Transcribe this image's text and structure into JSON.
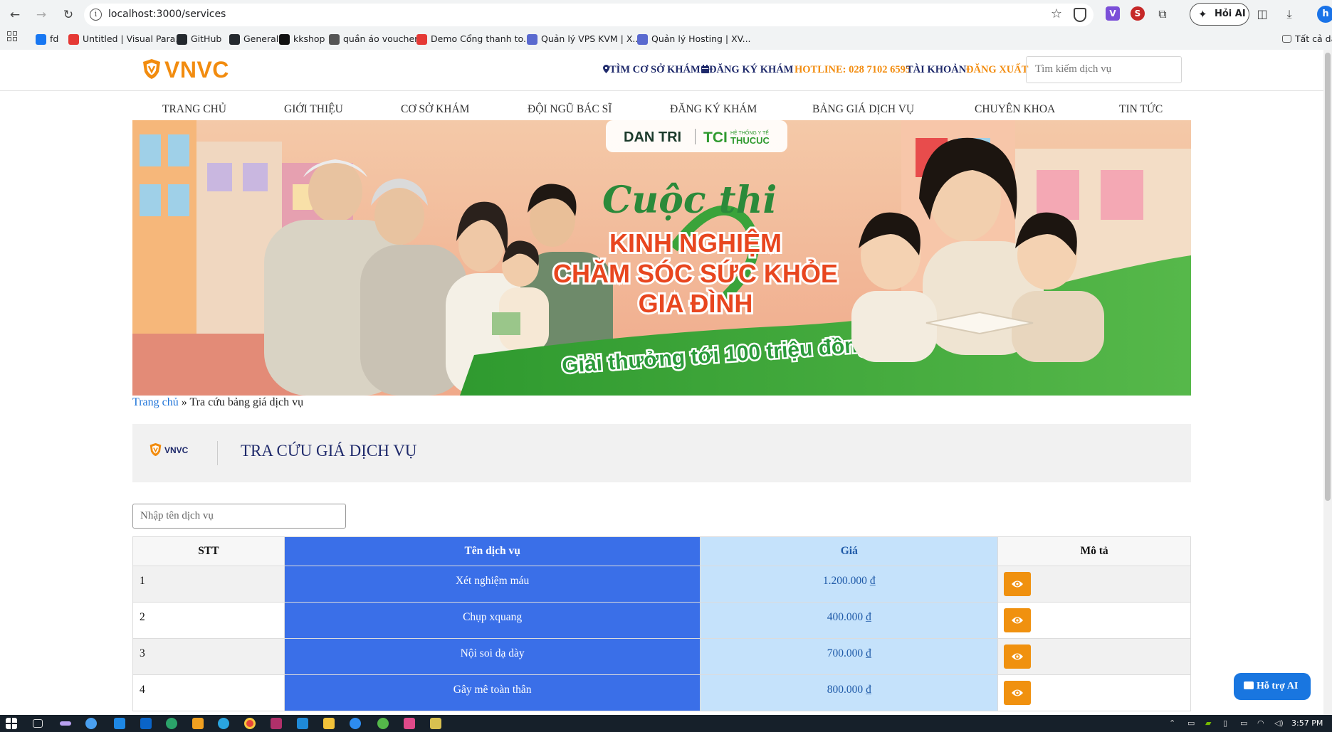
{
  "browser": {
    "url": "localhost:3000/services",
    "hoi_ai_label": "Hỏi AI",
    "profile_initial": "h",
    "bookmarks": [
      {
        "label": "fd",
        "icon": "facebook-icon",
        "color": "#1877f2"
      },
      {
        "label": "Untitled | Visual Para...",
        "icon": "visual-paradigm-icon",
        "color": "#e53935"
      },
      {
        "label": "GitHub",
        "icon": "github-icon",
        "color": "#24292e"
      },
      {
        "label": "General",
        "icon": "github-icon",
        "color": "#24292e"
      },
      {
        "label": "kkshop",
        "icon": "kkshop-icon",
        "color": "#111111"
      },
      {
        "label": "quần áo voucher",
        "icon": "voucher-icon",
        "color": "#555555"
      },
      {
        "label": "Demo Cổng thanh to...",
        "icon": "vnpay-icon",
        "color": "#e53935"
      },
      {
        "label": "Quản lý VPS KVM | X...",
        "icon": "person-icon",
        "color": "#5a6acf"
      },
      {
        "label": "Quản lý Hosting | XV...",
        "icon": "person-icon",
        "color": "#5a6acf"
      }
    ],
    "all_bookmarks_label": "Tất cả dấ"
  },
  "header": {
    "logo_text": "VNVC",
    "links": {
      "find_clinic": "TÌM CƠ SỞ KHÁM",
      "register": "ĐĂNG KÝ KHÁM",
      "hotline": "HOTLINE: 028 7102 6595",
      "account": "TÀI KHOẢN",
      "logout": "ĐĂNG XUẤT"
    },
    "search_placeholder": "Tìm kiếm dịch vụ"
  },
  "nav": [
    "TRANG CHỦ",
    "GIỚI THIỆU",
    "CƠ SỞ KHÁM",
    "ĐỘI NGŨ BÁC SĨ",
    "ĐĂNG KÝ KHÁM",
    "BẢNG GIÁ DỊCH VỤ",
    "CHUYÊN KHOA",
    "TIN TỨC"
  ],
  "banner": {
    "partner_1": "DAN TRI",
    "partner_2_mark": "TCI",
    "partner_2_sub": "HỆ THỐNG Y TẾ",
    "partner_2_name": "THUCUC",
    "script_title": "Cuộc thi",
    "line1": "KINH NGHIỆM",
    "line2": "CHĂM SÓC SỨC KHỎE",
    "line3": "GIA ĐÌNH",
    "prize": "Giải thưởng tới 100 triệu đồng"
  },
  "breadcrumb": {
    "home": "Trang chủ",
    "separator": "»",
    "current": "Tra cứu bảng giá dịch vụ"
  },
  "panel": {
    "logo_text": "VNVC",
    "title": "TRA CỨU GIÁ DỊCH VỤ"
  },
  "filter": {
    "placeholder": "Nhập tên dịch vụ"
  },
  "table": {
    "headers": {
      "stt": "STT",
      "name": "Tên dịch vụ",
      "price": "Giá",
      "desc": "Mô tả"
    },
    "rows": [
      {
        "stt": "1",
        "name": "Xét nghiệm máu",
        "price": "1.200.000 ₫"
      },
      {
        "stt": "2",
        "name": "Chụp xquang",
        "price": "400.000 ₫"
      },
      {
        "stt": "3",
        "name": "Nội soi dạ dày",
        "price": "700.000 ₫"
      },
      {
        "stt": "4",
        "name": "Gây mê toàn thân",
        "price": "800.000 ₫"
      }
    ]
  },
  "ai_help_label": "Hỗ trợ AI",
  "taskbar": {
    "clock": "3:57 PM"
  },
  "colors": {
    "brand_orange": "#f28c0f",
    "brand_navy": "#1f2a6b",
    "name_column": "#3a6fe8",
    "price_column": "#c5e2fb",
    "eye_button": "#f0910f"
  }
}
